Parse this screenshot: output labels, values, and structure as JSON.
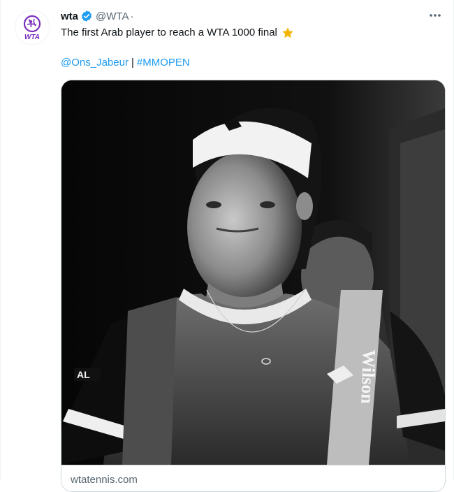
{
  "tweet": {
    "author_name": "wta",
    "author_handle": "@WTA",
    "dot": "·",
    "text": "The first Arab player to reach a WTA 1000 final",
    "mention": "@Ons_Jabeur",
    "separator": "|",
    "hashtag": "#MMOPEN",
    "avatar_logo_text": "WTA",
    "card_domain": "wtatennis.com",
    "photo_shirt_text": "AL",
    "photo_strap_brand": "Wilson"
  },
  "icons": {
    "verified": "verified-badge-icon",
    "more": "more-options-icon",
    "star": "star-emoji-icon"
  },
  "colors": {
    "accent": "#1d9bf0",
    "brand_purple": "#7b2fbe",
    "star": "#f4b400"
  }
}
